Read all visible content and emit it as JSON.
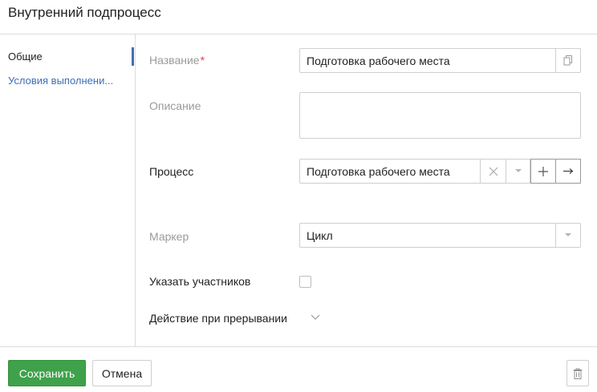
{
  "window": {
    "title": "Внутренний подпроцесс"
  },
  "sidebar": {
    "items": [
      {
        "label": "Общие",
        "active": true
      },
      {
        "label": "Условия выполнени..."
      }
    ]
  },
  "form": {
    "name": {
      "label": "Название",
      "required_mark": "*",
      "value": "Подготовка рабочего места",
      "icon": "copy-icon"
    },
    "description": {
      "label": "Описание",
      "value": ""
    },
    "process": {
      "label": "Процесс",
      "value": "Подготовка рабочего места",
      "icons": [
        "clear-icon",
        "chevron-down-icon",
        "plus-icon",
        "arrow-right-icon"
      ]
    },
    "marker": {
      "label": "Маркер",
      "value": "Цикл",
      "icon": "chevron-down-icon"
    },
    "participants": {
      "label": "Указать участников",
      "checked": false
    },
    "interrupt": {
      "label": "Действие при прерывании",
      "icon": "chevron-down-icon"
    }
  },
  "footer": {
    "save_label": "Сохранить",
    "cancel_label": "Отмена",
    "delete_icon": "trash-icon"
  },
  "colors": {
    "accent": "#3e6fb5",
    "save_green": "#3fa14a",
    "required": "#e0424a",
    "muted_label": "#9a9a9a"
  }
}
